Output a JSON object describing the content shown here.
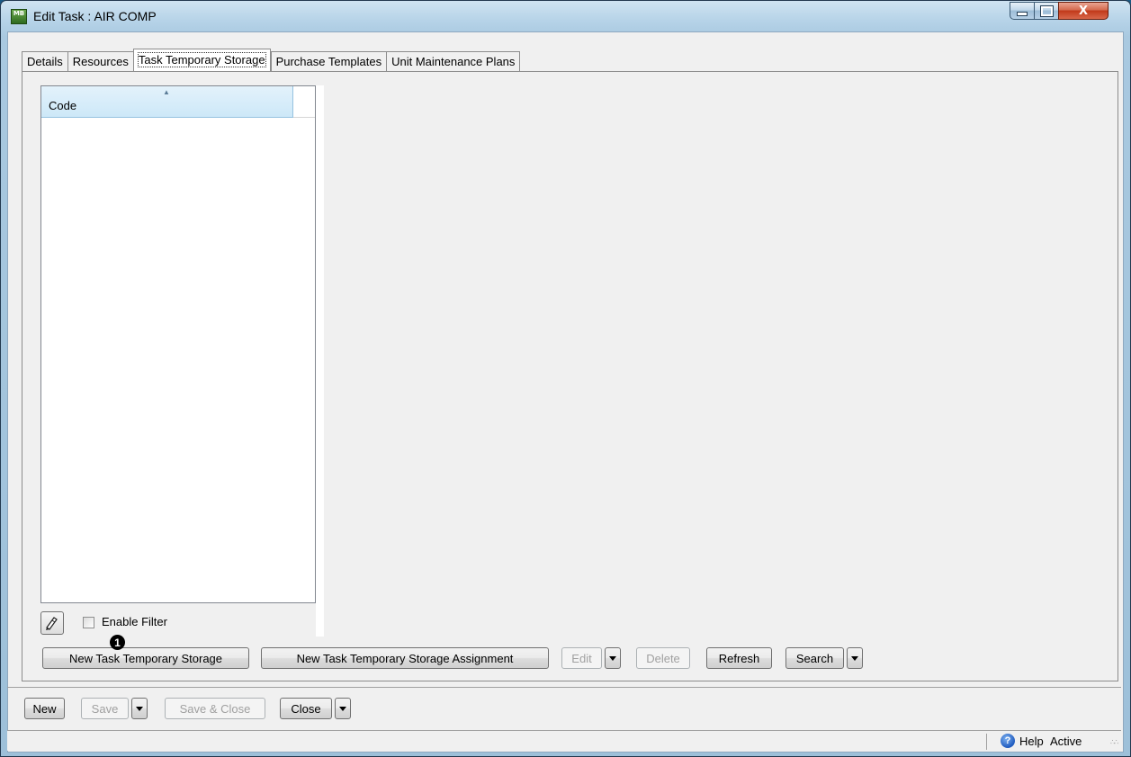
{
  "window": {
    "title": "Edit Task : AIR COMP",
    "app_icon_text": "MB",
    "close_glyph": "X"
  },
  "tabs": [
    {
      "label": "Details"
    },
    {
      "label": "Resources"
    },
    {
      "label": "Task Temporary Storage",
      "active": true
    },
    {
      "label": "Purchase Templates"
    },
    {
      "label": "Unit Maintenance Plans"
    }
  ],
  "grid": {
    "columns": [
      "Code"
    ],
    "rows": []
  },
  "filter": {
    "checkbox_label": "Enable Filter",
    "checked": false
  },
  "panel_buttons": {
    "new_storage": "New Task Temporary Storage",
    "new_assignment": "New Task Temporary Storage Assignment",
    "edit": "Edit",
    "delete": "Delete",
    "refresh": "Refresh",
    "search": "Search"
  },
  "callout_badge": "1",
  "bottom_buttons": {
    "new": "New",
    "save": "Save",
    "save_close": "Save & Close",
    "close": "Close"
  },
  "status": {
    "help": "Help",
    "state": "Active"
  }
}
